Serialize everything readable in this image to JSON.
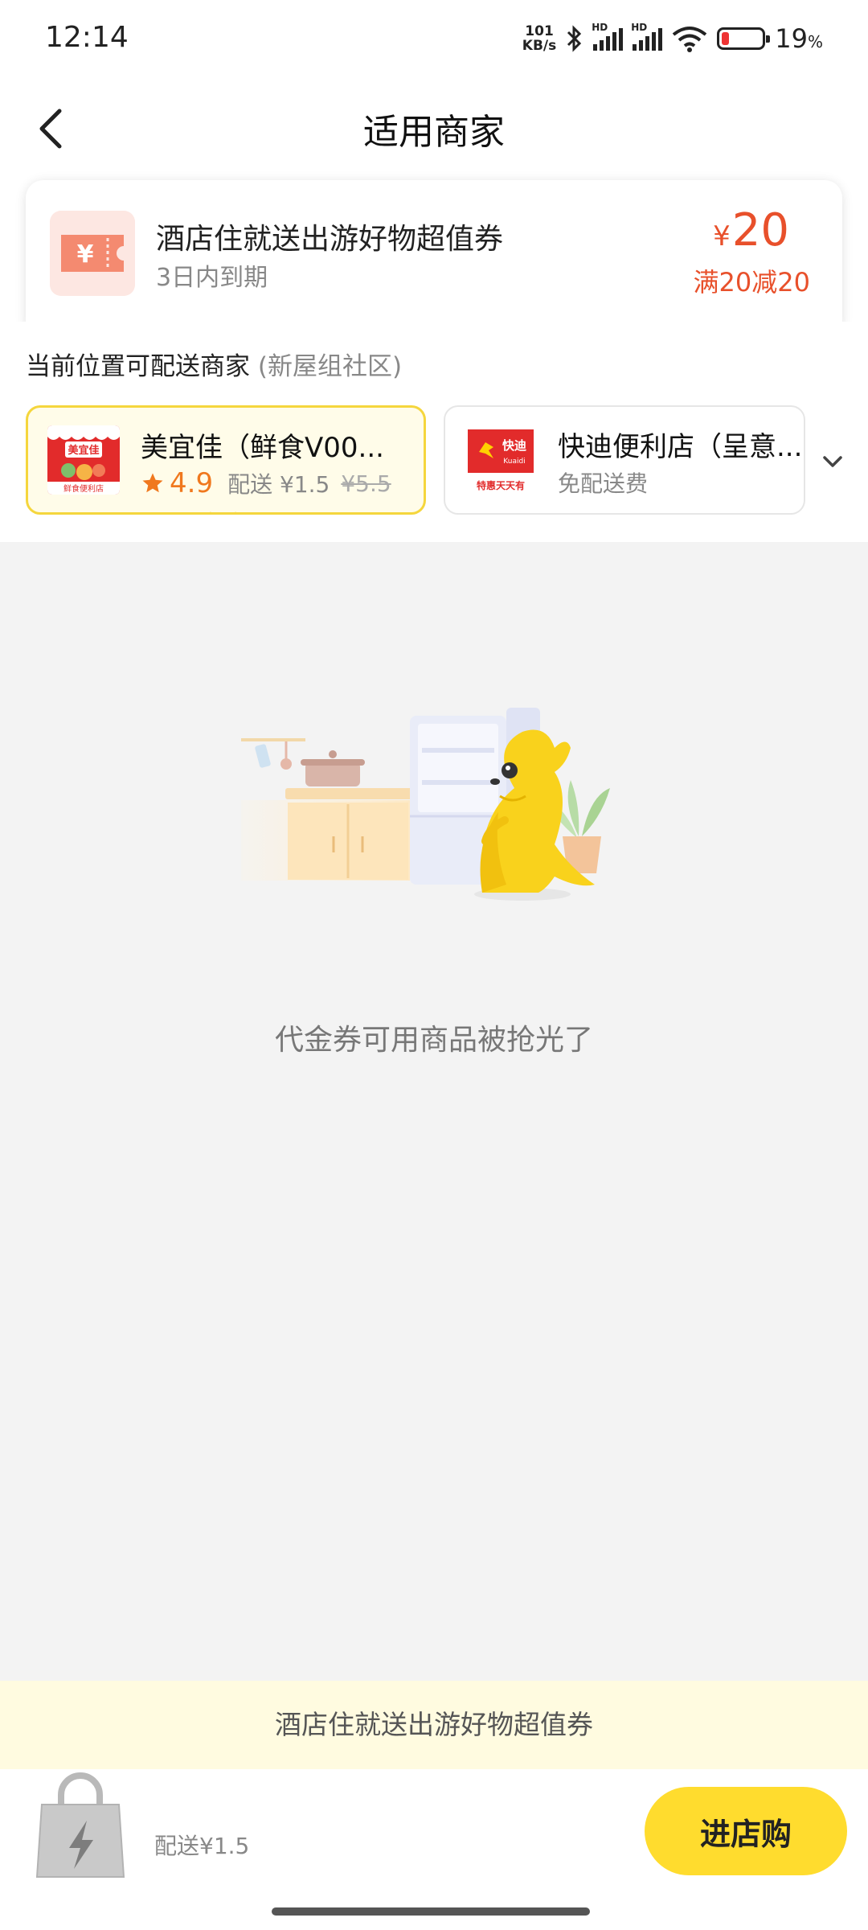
{
  "status_bar": {
    "time": "12:14",
    "net_speed_value": "101",
    "net_speed_unit": "KB/s",
    "hd_label": "HD",
    "battery_percent": "19",
    "battery_unit": "%",
    "battery_level": 0.19
  },
  "header": {
    "title": "适用商家"
  },
  "coupon": {
    "title": "酒店住就送出游好物超值券",
    "expire": "3日内到期",
    "currency": "¥",
    "amount": "20",
    "rule": "满20减20",
    "icon_symbol": "¥",
    "color": "#e8502b"
  },
  "stores": {
    "heading": "当前位置可配送商家",
    "location": "(新屋组社区)",
    "items": [
      {
        "name": "美宜佳（鲜食V00...",
        "logo_text": "美宜佳",
        "logo_sub": "鲜食便利店",
        "rating": "4.9",
        "delivery": "配送 ¥1.5",
        "delivery_original": "¥5.5",
        "selected": true
      },
      {
        "name": "快迪便利店（呈意...",
        "logo_text": "快迪",
        "logo_sub": "特惠天天有",
        "delivery": "免配送费",
        "selected": false
      }
    ]
  },
  "empty_state": {
    "message": "代金券可用商品被抢光了"
  },
  "bottom": {
    "banner": "酒店住就送出游好物超值券",
    "delivery_fee": "配送¥1.5",
    "enter_button": "进店购"
  },
  "colors": {
    "accent_yellow": "#ffdc2e",
    "price_red": "#e8502b",
    "rating_orange": "#f0781e"
  }
}
